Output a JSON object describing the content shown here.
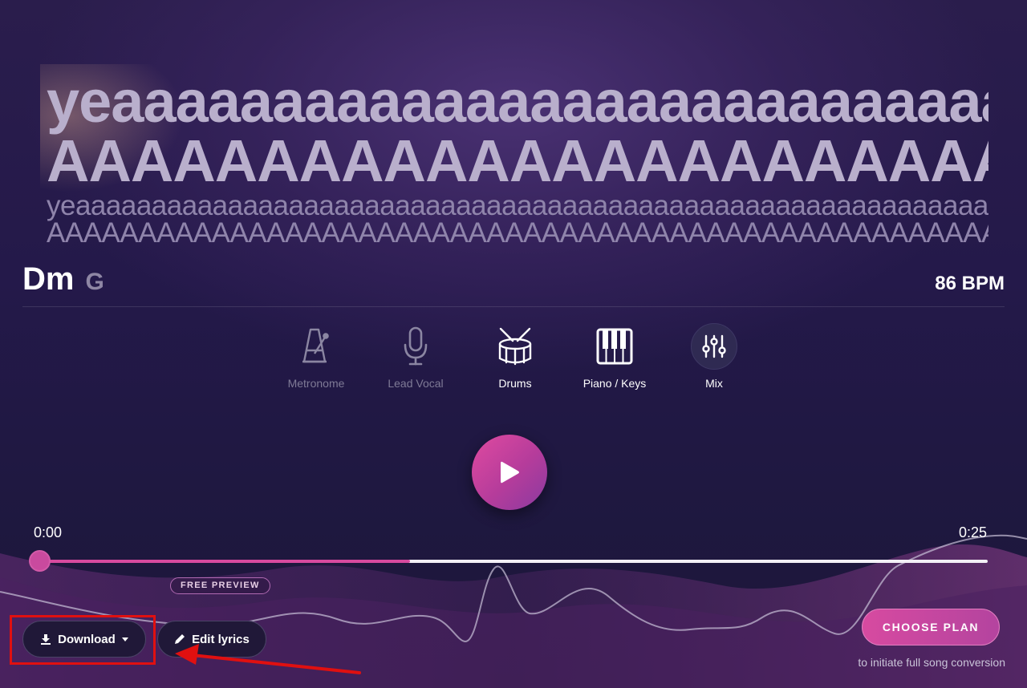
{
  "lyrics": {
    "big_line_1": "yeaaaaaaaaaaaaaaaaaaaaaaaaaaaaaaaaaa",
    "big_line_2": "AAAAAAAAAAAAAAAAAAAAAAAAAAAAAAA",
    "small_line_1": "yeaaaaaaaaaaaaaaaaaaaaaaaaaaaaaaaaaaaaaaaaaaaaaaaaaaaaaaaaaaaaaaaaaaaaaaaaaaaaaaaaaaaaaaaaaaa",
    "small_line_2": "AAAAAAAAAAAAAAAAAAAAAAAAAAAAAAAAAAAAAAAAAAAAAAAAAAAAAAAAAAAAAAAAAAAAAAAAAAA"
  },
  "chords": {
    "current": "Dm",
    "next": "G"
  },
  "bpm": "86 BPM",
  "instruments": [
    {
      "label": "Metronome",
      "icon": "metronome-icon",
      "active": false
    },
    {
      "label": "Lead Vocal",
      "icon": "microphone-icon",
      "active": false
    },
    {
      "label": "Drums",
      "icon": "drum-icon",
      "active": true
    },
    {
      "label": "Piano / Keys",
      "icon": "piano-keys-icon",
      "active": true
    },
    {
      "label": "Mix",
      "icon": "mixer-sliders-icon",
      "active": true
    }
  ],
  "player": {
    "time_start": "0:00",
    "time_end": "0:25",
    "progress": 0,
    "preview_fraction": 0.39,
    "free_preview_label": "FREE PREVIEW"
  },
  "actions": {
    "download_label": "Download",
    "edit_lyrics_label": "Edit lyrics",
    "choose_plan_label": "CHOOSE PLAN",
    "plan_note": "to initiate full song conversion"
  },
  "colors": {
    "accent": "#d74aa0",
    "annotation_red": "#e01010",
    "background": "#241a48"
  }
}
